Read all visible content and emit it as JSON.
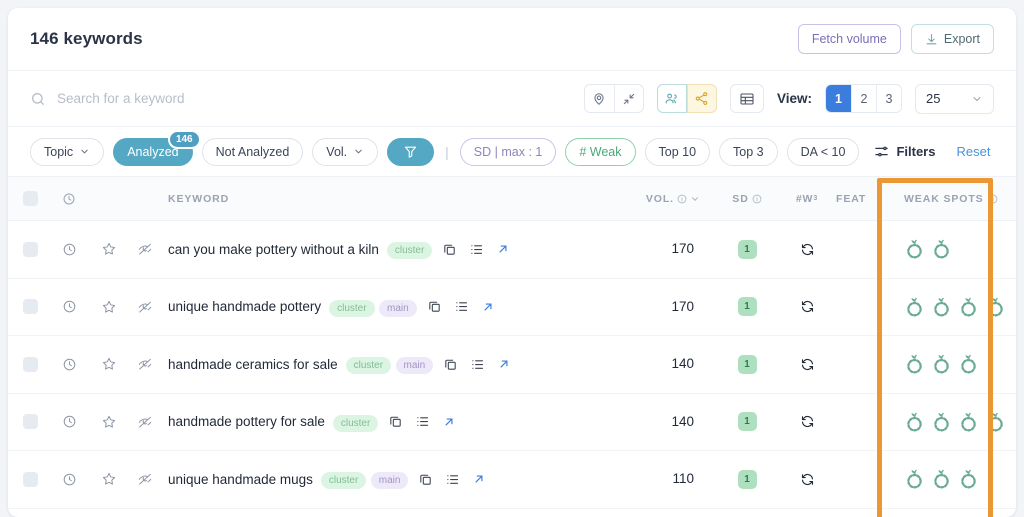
{
  "header": {
    "title": "146 keywords",
    "fetch_label": "Fetch volume",
    "export_label": "Export"
  },
  "search": {
    "placeholder": "Search for a keyword",
    "value": ""
  },
  "toolbar": {
    "view_label": "View:",
    "pages": [
      "1",
      "2",
      "3"
    ],
    "active_page": "1",
    "per_page": "25",
    "icons": [
      "location-pin-icon",
      "collapse-icon",
      "audience-icon",
      "share-icon",
      "table-grid-icon"
    ]
  },
  "filters": {
    "topic": "Topic",
    "analyzed": "Analyzed",
    "analyzed_count": "146",
    "not_analyzed": "Not Analyzed",
    "vol": "Vol.",
    "sd_max": "SD | max : 1",
    "weak": "# Weak",
    "top10": "Top 10",
    "top3": "Top 3",
    "da": "DA < 10",
    "filters_label": "Filters",
    "reset_label": "Reset"
  },
  "table": {
    "columns": {
      "keyword": "KEYWORD",
      "vol": "VOL.",
      "sd": "SD",
      "w": "#W",
      "w_sup": "3",
      "feat": "FEAT",
      "weak_spots": "WEAK SPOTS"
    },
    "rows": [
      {
        "keyword": "can you make pottery without a kiln",
        "tags": [
          "cluster"
        ],
        "vol": "170",
        "sd": "1",
        "weak_spots": 2
      },
      {
        "keyword": "unique handmade pottery",
        "tags": [
          "cluster",
          "main"
        ],
        "vol": "170",
        "sd": "1",
        "weak_spots": 4
      },
      {
        "keyword": "handmade ceramics for sale",
        "tags": [
          "cluster",
          "main"
        ],
        "vol": "140",
        "sd": "1",
        "weak_spots": 3
      },
      {
        "keyword": "handmade pottery for sale",
        "tags": [
          "cluster"
        ],
        "vol": "140",
        "sd": "1",
        "weak_spots": 4
      },
      {
        "keyword": "unique handmade mugs",
        "tags": [
          "cluster",
          "main"
        ],
        "vol": "110",
        "sd": "1",
        "weak_spots": 3
      }
    ]
  },
  "colors": {
    "accent_blue": "#3b7ddd",
    "teal": "#55a8c4",
    "green": "#49a877",
    "purple": "#8d84bb",
    "highlight_orange": "#eb9733",
    "weak_icon": "#6aab95"
  }
}
